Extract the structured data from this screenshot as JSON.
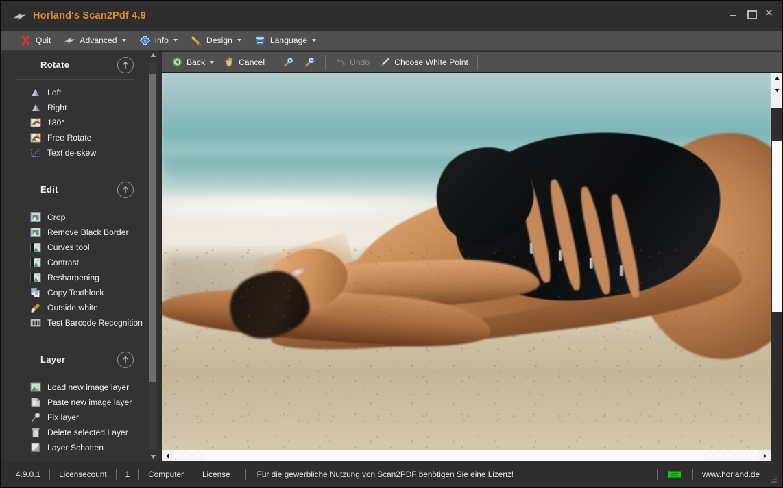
{
  "window": {
    "title": "Horland's Scan2Pdf 4.9",
    "controls": {
      "minimize": "–",
      "maximize": "□",
      "close": "✕"
    }
  },
  "menubar": {
    "items": [
      {
        "label": "Quit",
        "icon": "red-x-icon",
        "has_caret": false
      },
      {
        "label": "Advanced",
        "icon": "scanner-icon",
        "has_caret": true
      },
      {
        "label": "Info",
        "icon": "info-diamond-icon",
        "has_caret": true
      },
      {
        "label": "Design",
        "icon": "paintbrush-icon",
        "has_caret": true
      },
      {
        "label": "Language",
        "icon": "globe-icon",
        "has_caret": true
      }
    ]
  },
  "sidebar": {
    "groups": [
      {
        "title": "Rotate",
        "collapse_icon": "circle-up-arrow-icon",
        "items": [
          {
            "label": "Left",
            "icon": "rotate-left-icon"
          },
          {
            "label": "Right",
            "icon": "rotate-right-icon"
          },
          {
            "label": "180°",
            "icon": "rotate-180-icon"
          },
          {
            "label": "Free Rotate",
            "icon": "free-rotate-icon"
          },
          {
            "label": "Text de-skew",
            "icon": "deskew-icon"
          }
        ]
      },
      {
        "title": "Edit",
        "collapse_icon": "circle-up-arrow-icon",
        "items": [
          {
            "label": "Crop",
            "icon": "crop-icon"
          },
          {
            "label": "Remove Black Border",
            "icon": "remove-border-icon"
          },
          {
            "label": "Curves tool",
            "icon": "curves-icon"
          },
          {
            "label": "Contrast",
            "icon": "contrast-icon"
          },
          {
            "label": "Resharpening",
            "icon": "resharpen-icon"
          },
          {
            "label": "Copy Textblock",
            "icon": "copy-textblock-icon"
          },
          {
            "label": "Outside white",
            "icon": "brush-icon"
          },
          {
            "label": "Test Barcode Recognition",
            "icon": "barcode-icon"
          }
        ]
      },
      {
        "title": "Layer",
        "collapse_icon": "circle-up-arrow-icon",
        "items": [
          {
            "label": "Load new image layer",
            "icon": "image-layer-icon"
          },
          {
            "label": "Paste new image layer",
            "icon": "paste-icon"
          },
          {
            "label": "Fix layer",
            "icon": "pin-icon"
          },
          {
            "label": "Delete selected Layer",
            "icon": "trash-icon"
          },
          {
            "label": "Layer Schatten",
            "icon": "layer-shadow-icon"
          }
        ]
      }
    ]
  },
  "image_toolbar": {
    "buttons": [
      {
        "label": "Back",
        "icon": "back-arrow-icon",
        "has_caret": true,
        "disabled": false
      },
      {
        "label": "Cancel",
        "icon": "cancel-hand-icon",
        "has_caret": false,
        "disabled": false
      },
      {
        "label": "",
        "icon": "zoom-in-icon",
        "has_caret": false,
        "disabled": false
      },
      {
        "label": "",
        "icon": "zoom-out-icon",
        "has_caret": false,
        "disabled": false
      },
      {
        "label": "Undo",
        "icon": "undo-icon",
        "has_caret": false,
        "disabled": true
      },
      {
        "label": "Choose White Point",
        "icon": "eyedropper-icon",
        "has_caret": false,
        "disabled": false
      }
    ]
  },
  "canvas": {
    "photo_alt": "Woman in black swimsuit lying on beach sand with turquoise sea behind",
    "scroll": {
      "vertical": "partial",
      "horizontal": "partial"
    }
  },
  "statusbar": {
    "version": "4.9.0.1",
    "license_count_label": "Licensecount",
    "license_count_value": "1",
    "computer_label": "Computer",
    "license_label": "License",
    "message": "Für die gewerbliche Nutzung von Scan2PDF benötigen Sie eine Lizenz!",
    "flag_icon": "green-flag-icon",
    "website": "www.horland.de"
  },
  "colors": {
    "title_bar": "#2e2e2e",
    "menu_bar": "#505050",
    "sidebar": "#333333",
    "accent_title": "#e08a2e",
    "text": "#ededed",
    "flag_green": "#19c419"
  }
}
